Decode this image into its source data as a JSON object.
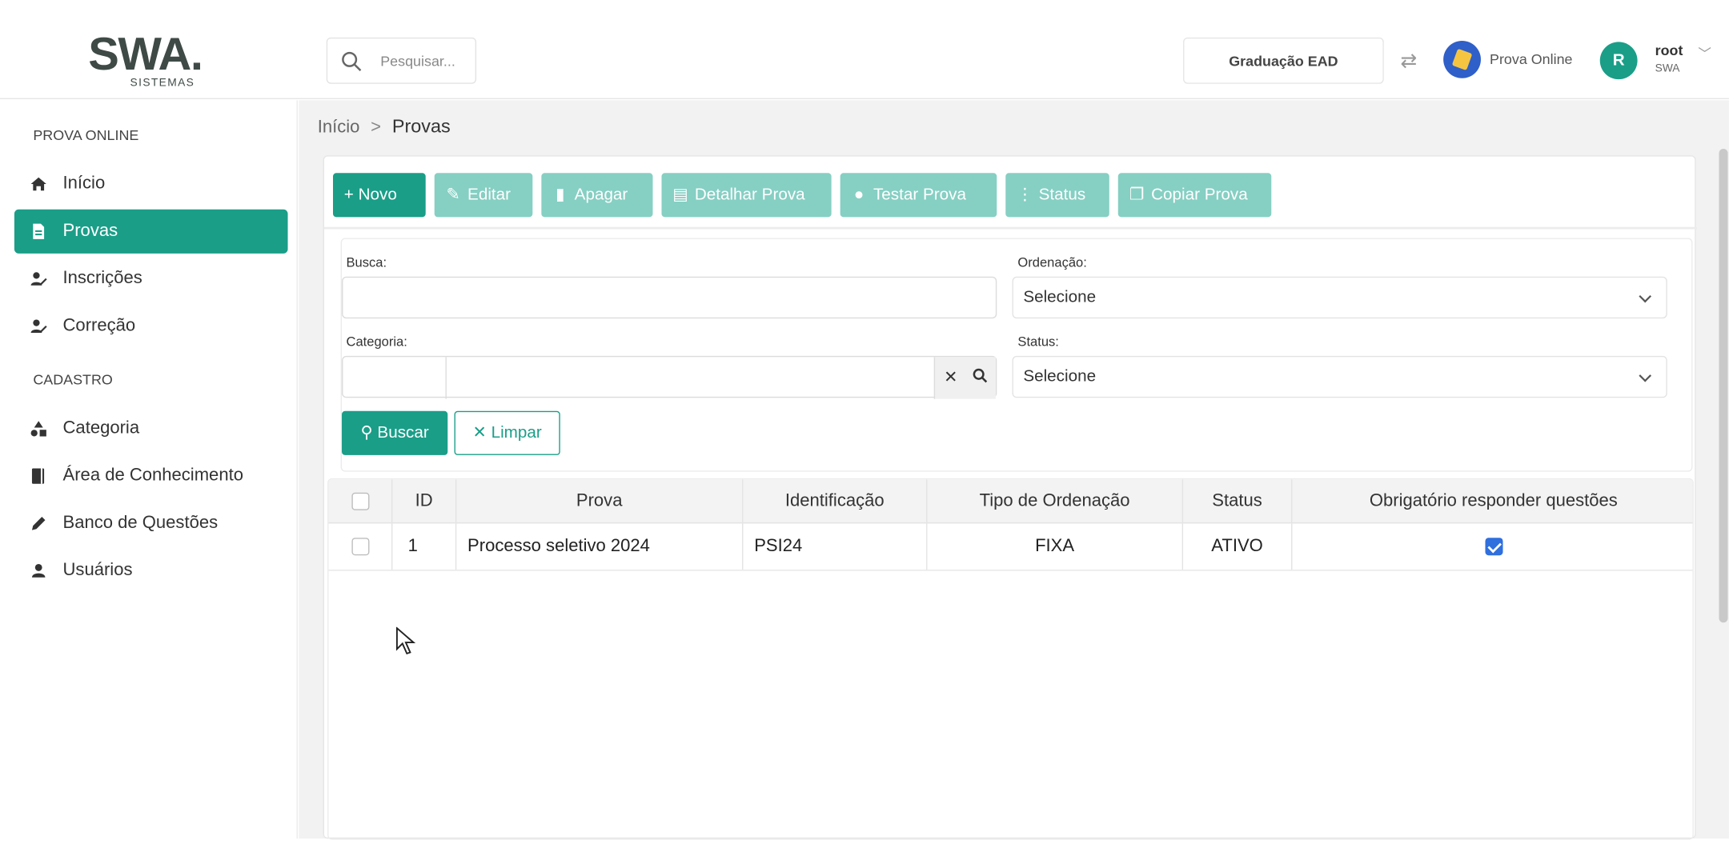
{
  "header": {
    "logo_text": "SWA.",
    "logo_sub": "SISTEMAS",
    "search_placeholder": "Pesquisar...",
    "context_button": "Graduação EAD",
    "app_name": "Prova Online",
    "user_initial": "R",
    "user_name": "root",
    "user_org": "SWA"
  },
  "sidebar": {
    "section1": "PROVA ONLINE",
    "section2": "CADASTRO",
    "items": [
      {
        "label": "Início",
        "icon": "home-icon"
      },
      {
        "label": "Provas",
        "icon": "document-icon",
        "active": true
      },
      {
        "label": "Inscrições",
        "icon": "user-edit-icon"
      },
      {
        "label": "Correção",
        "icon": "user-edit-icon"
      },
      {
        "label": "Categoria",
        "icon": "shapes-icon"
      },
      {
        "label": "Área de Conhecimento",
        "icon": "book-icon"
      },
      {
        "label": "Banco de Questões",
        "icon": "pencil-icon"
      },
      {
        "label": "Usuários",
        "icon": "user-icon"
      }
    ]
  },
  "breadcrumb": {
    "home": "Início",
    "sep": ">",
    "current": "Provas"
  },
  "toolbar": {
    "novo": "+ Novo",
    "editar": "Editar",
    "apagar": "Apagar",
    "detalhar": "Detalhar Prova",
    "testar": "Testar Prova",
    "status": "Status",
    "copiar": "Copiar Prova"
  },
  "filters": {
    "busca_label": "Busca:",
    "busca_value": "",
    "ordenacao_label": "Ordenação:",
    "ordenacao_value": "Selecione",
    "categoria_label": "Categoria:",
    "status_label": "Status:",
    "status_value": "Selecione",
    "buscar_button": "Buscar",
    "limpar_button": "Limpar"
  },
  "table": {
    "columns": [
      "ID",
      "Prova",
      "Identificação",
      "Tipo de Ordenação",
      "Status",
      "Obrigatório responder questões"
    ],
    "rows": [
      {
        "id": "1",
        "prova": "Processo seletivo 2024",
        "identificacao": "PSI24",
        "tipo": "FIXA",
        "status": "ATIVO",
        "obrigatorio": true
      }
    ]
  },
  "colors": {
    "accent": "#1a9e88",
    "accent_light": "#86cfc3",
    "checkbox_on": "#2f6fde"
  }
}
